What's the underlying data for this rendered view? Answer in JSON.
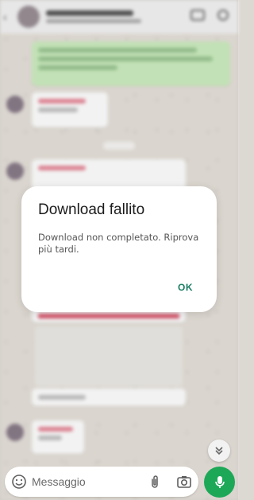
{
  "dialog": {
    "title": "Download fallito",
    "message": "Download non completato. Riprova più tardi.",
    "ok_label": "OK"
  },
  "composer": {
    "placeholder": "Messaggio"
  },
  "icons": {
    "emoji": "emoji-icon",
    "attach": "paperclip-icon",
    "camera": "camera-icon",
    "mic": "mic-icon",
    "scroll": "chevron-double-down-icon",
    "back": "back-arrow-icon"
  },
  "colors": {
    "accent_green": "#1da858",
    "ok_text": "#1a7f64",
    "outgoing_bubble": "#cdeec0",
    "sender_name": "#e05c72"
  }
}
